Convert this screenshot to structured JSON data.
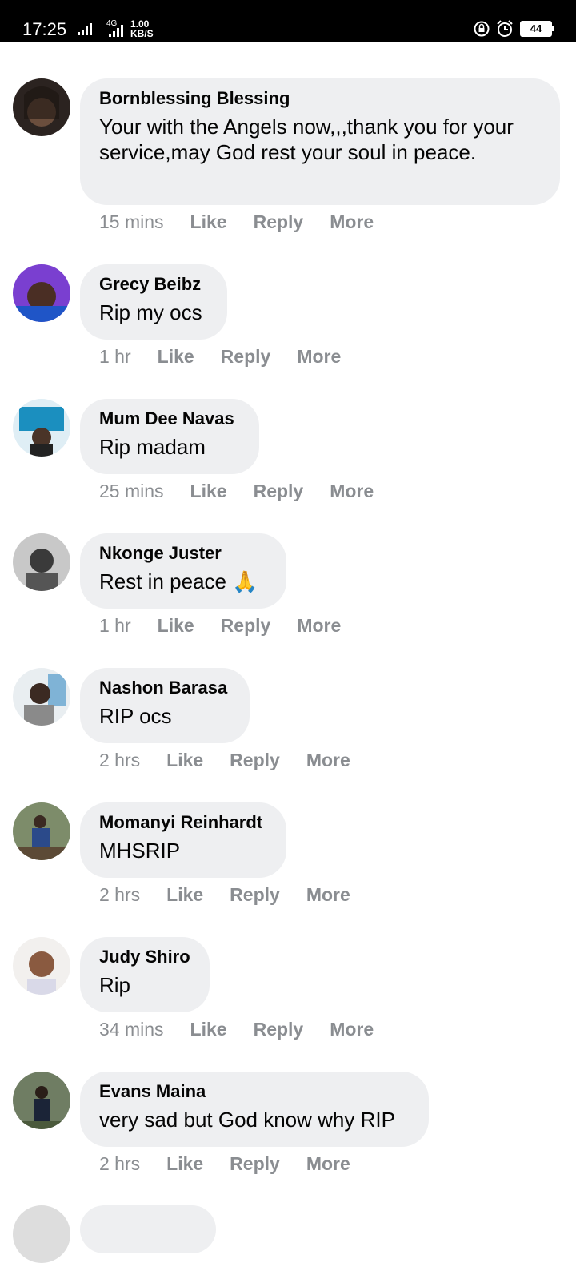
{
  "status_bar": {
    "time": "17:25",
    "network": "4G",
    "speed_value": "1.00",
    "speed_unit": "KB/S",
    "battery": "44",
    "icons": [
      "signal-icon",
      "lock-rotation-icon",
      "alarm-icon",
      "battery-icon"
    ]
  },
  "actions_labels": {
    "like": "Like",
    "reply": "Reply",
    "more": "More"
  },
  "colors": {
    "bubble": "#eeeff1",
    "muted": "#8a8d91",
    "text": "#050505"
  },
  "comments": [
    {
      "author": "Bornblessing Blessing",
      "text": "Your with the Angels now,,,thank you for your service,may God rest your soul in peace.",
      "time": "15 mins"
    },
    {
      "author": "Grecy Beibz",
      "text": "Rip my ocs",
      "time": "1 hr"
    },
    {
      "author": "Mum Dee Navas",
      "text": "Rip madam",
      "time": "25 mins"
    },
    {
      "author": "Nkonge Juster",
      "text": "Rest in peace 🙏",
      "time": "1 hr"
    },
    {
      "author": "Nashon Barasa",
      "text": "RIP ocs",
      "time": "2 hrs"
    },
    {
      "author": "Momanyi Reinhardt",
      "text": "MHSRIP",
      "time": "2 hrs"
    },
    {
      "author": "Judy Shiro",
      "text": "Rip",
      "time": "34 mins"
    },
    {
      "author": "Evans Maina",
      "text": "very sad but God know why RIP",
      "time": "2 hrs"
    }
  ]
}
